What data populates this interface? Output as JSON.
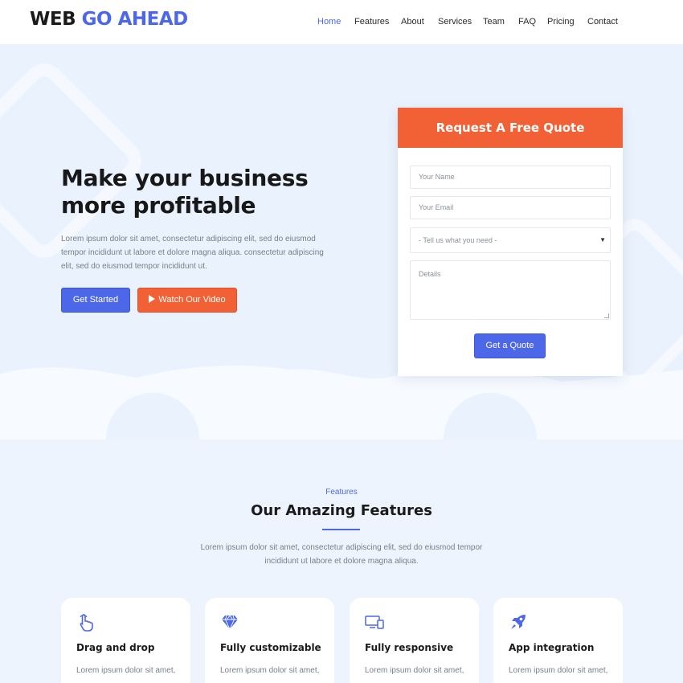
{
  "header": {
    "logo_part1": "WEB",
    "logo_part2": "GO AHEAD",
    "nav": [
      "Home",
      "Features",
      "About",
      "Services",
      "Team",
      "FAQ",
      "Pricing",
      "Contact"
    ],
    "active_nav": "Home"
  },
  "hero": {
    "title": "Make your business more profitable",
    "text": "Lorem ipsum dolor sit amet, consectetur adipiscing elit, sed do eiusmod tempor incididunt ut labore et dolore magna aliqua. consectetur adipiscing elit, sed do eiusmod tempor incididunt ut.",
    "btn_start": "Get Started",
    "btn_video": "Watch Our Video"
  },
  "quote": {
    "title": "Request A Free Quote",
    "name_placeholder": "Your Name",
    "email_placeholder": "Your Email",
    "select_value": "- Tell us what you need -",
    "details_placeholder": "Details",
    "submit": "Get a Quote"
  },
  "features": {
    "kicker": "Features",
    "title": "Our Amazing Features",
    "text": "Lorem ipsum dolor sit amet, consectetur adipiscing elit, sed do eiusmod tempor incididunt ut labore et dolore magna aliqua.",
    "cards": [
      {
        "title": "Drag and drop",
        "desc": "Lorem ipsum dolor sit amet,",
        "icon": "hand-pointer-icon"
      },
      {
        "title": "Fully customizable",
        "desc": "Lorem ipsum dolor sit amet,",
        "icon": "diamond-icon"
      },
      {
        "title": "Fully responsive",
        "desc": "Lorem ipsum dolor sit amet,",
        "icon": "devices-icon"
      },
      {
        "title": "App integration",
        "desc": "Lorem ipsum dolor sit amet,",
        "icon": "rocket-icon"
      }
    ]
  },
  "colors": {
    "primary": "#4c68e8",
    "accent": "#f26135",
    "background": "#eef4fe"
  }
}
